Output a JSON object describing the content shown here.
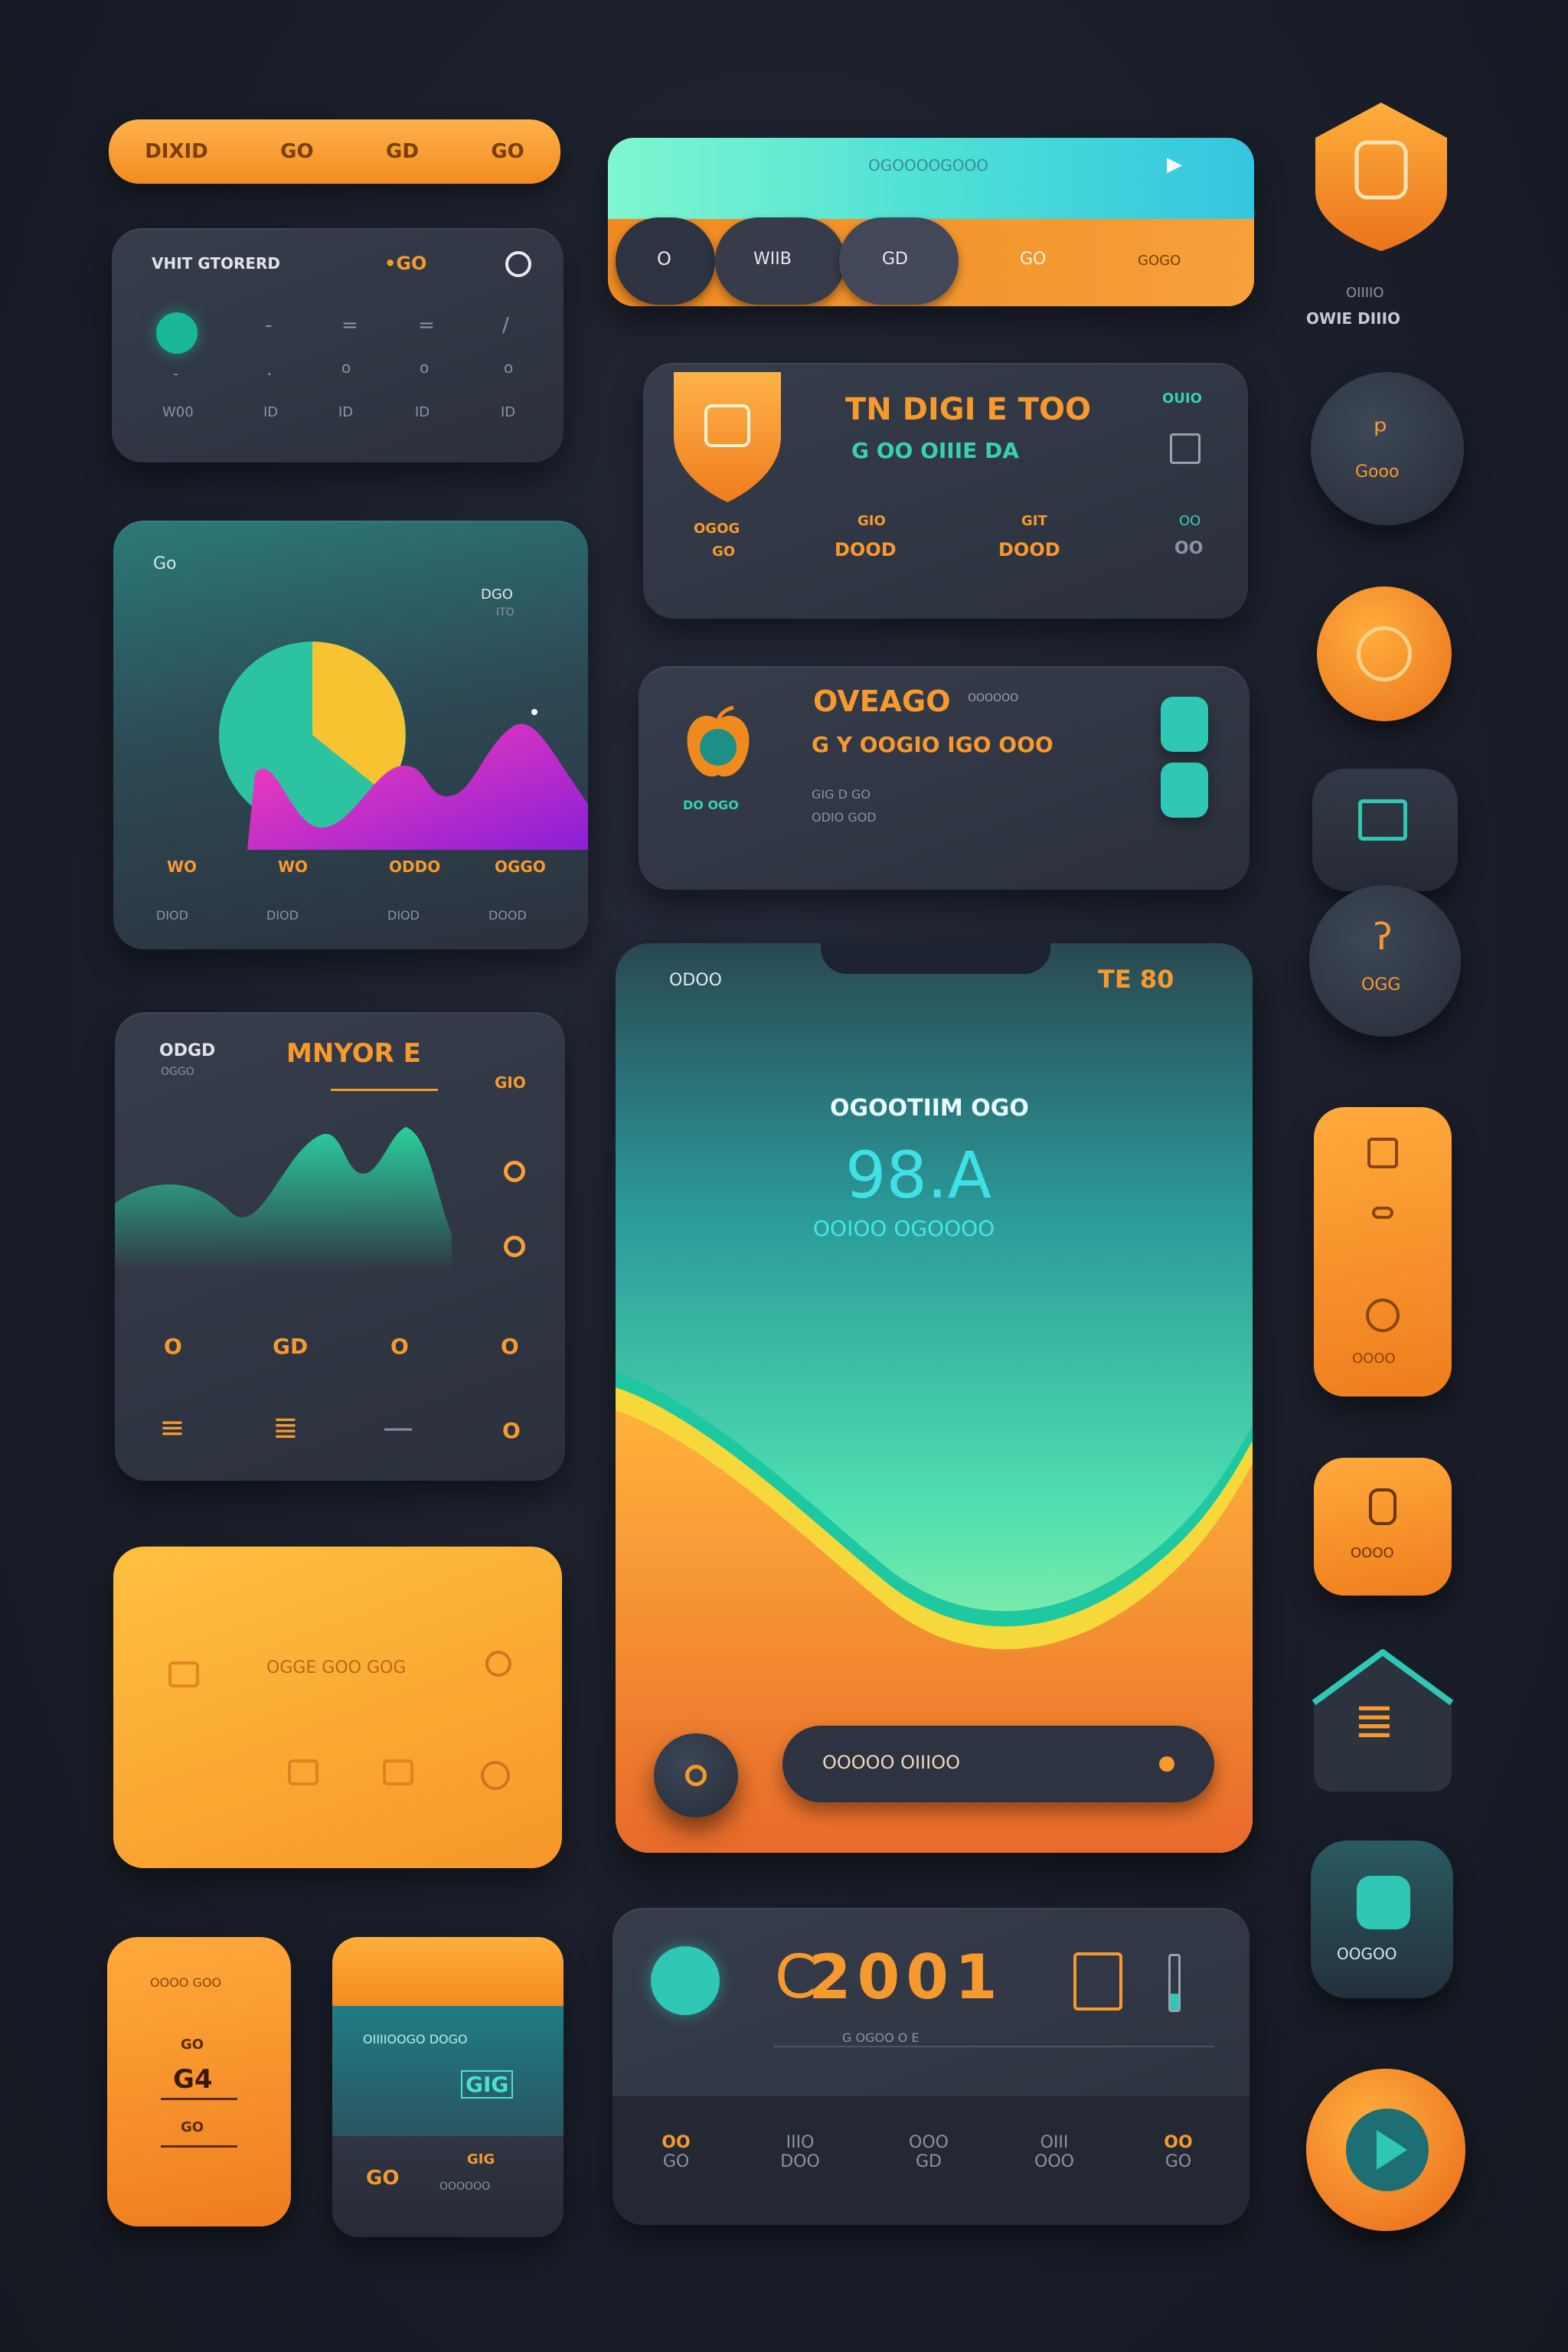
{
  "top_nav": {
    "items": [
      "DIXID",
      "GO",
      "GD",
      "GO"
    ]
  },
  "stats_card": {
    "title": "VHIT GTORERD",
    "value": "•GO",
    "columns": [
      {
        "top": "",
        "mid": "-",
        "bottom": "W00"
      },
      {
        "top": "-",
        "mid": ".",
        "bottom": "ID"
      },
      {
        "top": "=",
        "mid": "o",
        "bottom": "ID"
      },
      {
        "top": "=",
        "mid": "o",
        "bottom": "ID"
      },
      {
        "top": "/",
        "mid": "o",
        "bottom": "ID"
      }
    ]
  },
  "chart_card": {
    "title": "Go",
    "corner_top": "DGO",
    "corner_bottom": "ITO",
    "labels_row1": [
      "WO",
      "WO",
      "ODDO",
      "OGGO"
    ],
    "labels_row2": [
      "DIOD",
      "DIOD",
      "DIOD",
      "DOOD"
    ]
  },
  "wave_card": {
    "left_title": "ODGD",
    "left_sub": "OGGO",
    "main_title": "MNYOR E",
    "right_title": "GIO",
    "row_icons": [
      "O",
      "GD",
      "O",
      "O"
    ],
    "bottom_row": [
      "≡",
      "≣",
      "—",
      "O"
    ]
  },
  "orange_panel": {
    "center_label": "OGGE GOO GOG"
  },
  "small_orange": {
    "top": "OOOO GOO",
    "mid": "GO",
    "value": "G4",
    "bottom": "GO"
  },
  "split_card": {
    "title": "OIIIIOOGO DOGO",
    "code": "GIG",
    "footer_left": "GO",
    "footer_right": "GIG",
    "footer_sub": "OOOOOO"
  },
  "hero_bar": {
    "title": "OGOOOOGOOO",
    "tabs": [
      "O",
      "WIIB",
      "GD",
      "GO",
      "GOGO"
    ]
  },
  "shield_card": {
    "title": "TN DIGI E TOO",
    "subtitle": "G OO OIIIE DA",
    "badge": "OUIO",
    "cols": [
      {
        "top": "OGOG",
        "bottom": "GO"
      },
      {
        "top": "GIO",
        "bottom": "DOOD"
      },
      {
        "top": "GIT",
        "bottom": "DOOD"
      }
    ],
    "side_top": "OO",
    "side_bottom": "OO"
  },
  "task_card": {
    "title": "OVEAGO",
    "line": "G Y OOGIO IGO  OOO",
    "tag": "DO OGO",
    "meta1": "GIG D GO",
    "meta2": "ODIO GOD",
    "chip": "OOOOOO"
  },
  "phone": {
    "status_left": "ODOO",
    "status_right": "TE 80",
    "headline": "OGOOTIIM OGO",
    "big_value": "98.A",
    "caption": "OOIOO OGOOOO",
    "search_label": "OOOOO OIIIOO"
  },
  "score_card": {
    "value": "2001",
    "prefix": "C",
    "sub": "G OGOO O E",
    "dock": [
      "OO",
      "IIIO",
      "OOO",
      "OIII",
      "OO"
    ],
    "dock_sub": [
      "GO",
      "DOO",
      "GD",
      "OOO",
      "GO"
    ]
  },
  "right_column": {
    "shield_caption_top": "OIIIIO",
    "shield_caption": "OWIE DIIIO",
    "btn1_label": "Gooo",
    "btn2_label": "OGG",
    "tall_label": "OOOO",
    "tile_label": "OOOO",
    "green_label": "OOGOO"
  }
}
